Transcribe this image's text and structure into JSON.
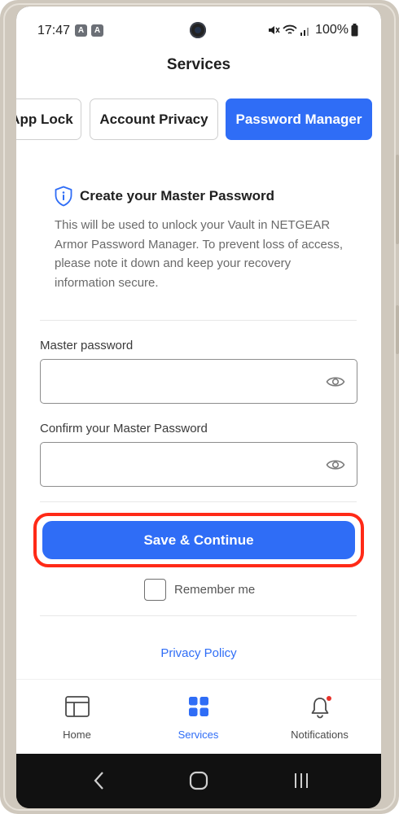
{
  "status_bar": {
    "time": "17:47",
    "badges": [
      "A",
      "A"
    ],
    "battery": "100%"
  },
  "header": {
    "title": "Services"
  },
  "tabs": [
    {
      "label": "App Lock",
      "active": false
    },
    {
      "label": "Account Privacy",
      "active": false
    },
    {
      "label": "Password Manager",
      "active": true
    }
  ],
  "intro": {
    "title": "Create your Master Password",
    "body": "This will be used to unlock your Vault in NETGEAR Armor Password Manager. To prevent loss of access, please note it down and keep your recovery information secure."
  },
  "form": {
    "master_label": "Master password",
    "master_value": "",
    "master_placeholder": "",
    "confirm_label": "Confirm your Master Password",
    "confirm_value": "",
    "confirm_placeholder": "",
    "save_label": "Save & Continue",
    "remember_label": "Remember me",
    "remember_checked": false
  },
  "privacy_link": "Privacy Policy",
  "bottom_nav": [
    {
      "label": "Home",
      "icon": "home-layout-icon",
      "active": false
    },
    {
      "label": "Services",
      "icon": "grid-icon",
      "active": true
    },
    {
      "label": "Notifications",
      "icon": "bell-icon",
      "active": false,
      "has_dot": true
    }
  ],
  "colors": {
    "accent": "#2f6df6",
    "highlight": "#ff2a17",
    "notification_dot": "#e8322a"
  }
}
